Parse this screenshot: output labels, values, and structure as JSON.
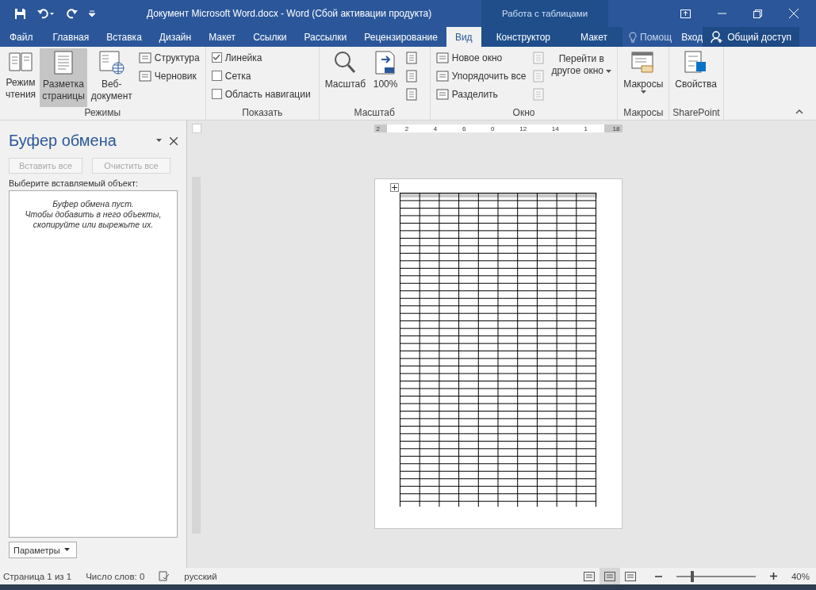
{
  "title_bar": {
    "title": "Документ Microsoft Word.docx - Word (Сбой активации продукта)",
    "context_group": "Работа с таблицами"
  },
  "tabs": [
    {
      "label": "Файл",
      "selected": false,
      "kind": "file"
    },
    {
      "label": "Главная",
      "selected": false,
      "kind": "normal"
    },
    {
      "label": "Вставка",
      "selected": false,
      "kind": "normal"
    },
    {
      "label": "Дизайн",
      "selected": false,
      "kind": "normal"
    },
    {
      "label": "Макет",
      "selected": false,
      "kind": "normal"
    },
    {
      "label": "Ссылки",
      "selected": false,
      "kind": "normal"
    },
    {
      "label": "Рассылки",
      "selected": false,
      "kind": "normal"
    },
    {
      "label": "Рецензирование",
      "selected": false,
      "kind": "normal"
    },
    {
      "label": "Вид",
      "selected": true,
      "kind": "normal"
    },
    {
      "label": "Конструктор",
      "selected": false,
      "kind": "context"
    },
    {
      "label": "Макет",
      "selected": false,
      "kind": "context"
    }
  ],
  "tell_me": "Помощ",
  "sign_in": "Вход",
  "share": "Общий доступ",
  "ribbon": [
    {
      "label": "Режимы",
      "items": [
        {
          "kind": "large",
          "label": [
            "Режим",
            "чтения"
          ],
          "selected": false
        },
        {
          "kind": "large",
          "label": [
            "Разметка",
            "страницы"
          ],
          "selected": true
        },
        {
          "kind": "large",
          "label": [
            "Веб-",
            "документ"
          ],
          "selected": false
        },
        {
          "kind": "stack",
          "items": [
            {
              "label": "Структура"
            },
            {
              "label": "Черновик"
            }
          ]
        }
      ]
    },
    {
      "label": "Показать",
      "items": [
        {
          "kind": "checks",
          "items": [
            {
              "label": "Линейка",
              "checked": true
            },
            {
              "label": "Сетка",
              "checked": false
            },
            {
              "label": "Область навигации",
              "checked": false
            }
          ]
        }
      ]
    },
    {
      "label": "Масштаб",
      "items": [
        {
          "kind": "large",
          "label": [
            "Масштаб"
          ],
          "selected": false
        },
        {
          "kind": "large",
          "label": [
            "100%"
          ],
          "selected": false
        },
        {
          "kind": "icons",
          "disabled": false
        }
      ]
    },
    {
      "label": "Окно",
      "items": [
        {
          "kind": "stack",
          "items": [
            {
              "label": "Новое окно"
            },
            {
              "label": "Упорядочить все"
            },
            {
              "label": "Разделить"
            }
          ]
        },
        {
          "kind": "icons",
          "disabled": true
        },
        {
          "kind": "large",
          "label": [
            "Перейти в",
            "другое окно"
          ],
          "selected": false,
          "menu": true
        }
      ]
    },
    {
      "label": "Макросы",
      "items": [
        {
          "kind": "large",
          "label": [
            "Макросы"
          ],
          "selected": false,
          "menu": true
        }
      ]
    },
    {
      "label": "SharePoint",
      "items": [
        {
          "kind": "large",
          "label": [
            "Свойства"
          ],
          "selected": false
        }
      ]
    }
  ],
  "clipboard": {
    "title": "Буфер обмена",
    "buttons": [
      {
        "label": "Вставить все",
        "disabled": true
      },
      {
        "label": "Очистить все",
        "disabled": true
      }
    ],
    "prompt": "Выберите вставляемый объект:",
    "empty_lines": [
      "Буфер обмена пуст.",
      "Чтобы добавить в него объекты, скопируйте или вырежьте их."
    ],
    "options": "Параметры"
  },
  "ruler": [
    "2",
    "2",
    "4",
    "6",
    "0",
    "12",
    "14",
    "1",
    "18"
  ],
  "status_bar": {
    "page": "Страница 1 из 1",
    "words": "Число слов: 0",
    "language": "русский",
    "views": [
      {
        "selected": false
      },
      {
        "selected": true
      },
      {
        "selected": false
      }
    ],
    "zoom": "40%",
    "level": 0.2
  }
}
